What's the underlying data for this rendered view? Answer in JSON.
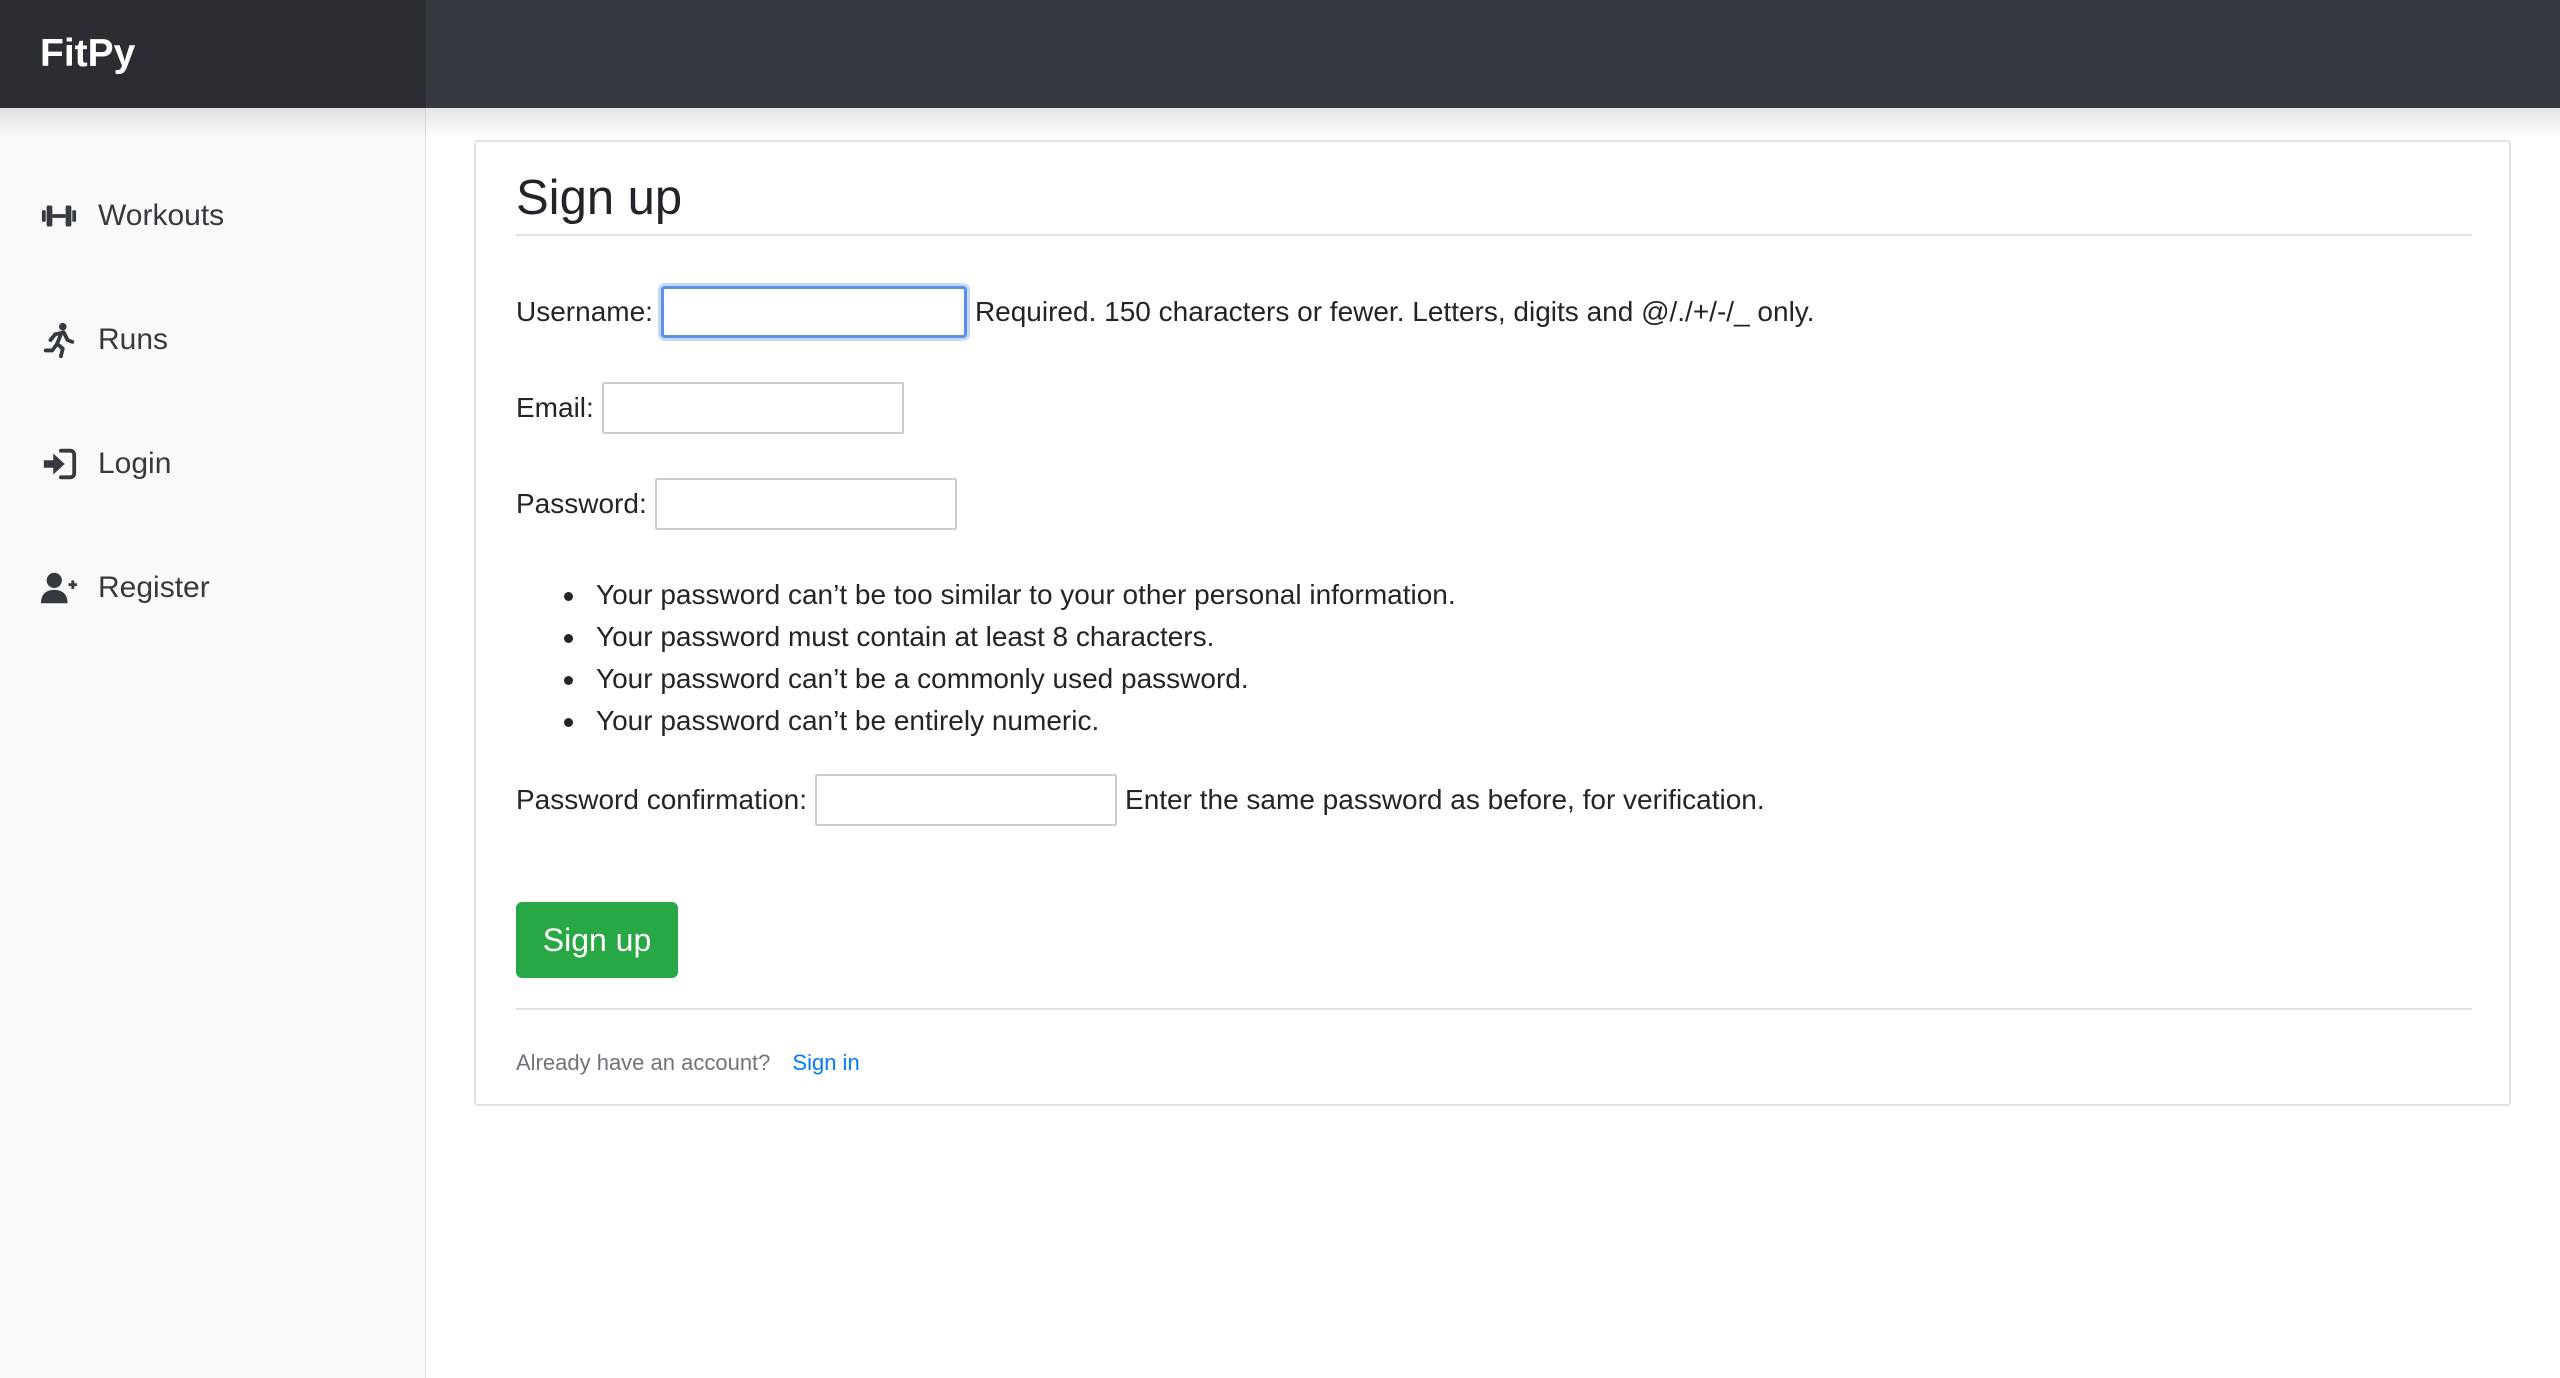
{
  "app": {
    "brand": "FitPy"
  },
  "sidebar": {
    "items": [
      {
        "label": "Workouts",
        "icon": "dumbbell-icon"
      },
      {
        "label": "Runs",
        "icon": "running-icon"
      },
      {
        "label": "Login",
        "icon": "sign-in-icon"
      },
      {
        "label": "Register",
        "icon": "user-plus-icon"
      }
    ]
  },
  "form": {
    "title": "Sign up",
    "username": {
      "label": "Username:",
      "value": "",
      "help": "Required. 150 characters or fewer. Letters, digits and @/./+/-/_ only."
    },
    "email": {
      "label": "Email:",
      "value": ""
    },
    "password": {
      "label": "Password:",
      "value": ""
    },
    "password_rules": [
      "Your password can’t be too similar to your other personal information.",
      "Your password must contain at least 8 characters.",
      "Your password can’t be a commonly used password.",
      "Your password can’t be entirely numeric."
    ],
    "password_confirmation": {
      "label": "Password confirmation:",
      "value": "",
      "help": "Enter the same password as before, for verification."
    },
    "submit_label": "Sign up"
  },
  "footer": {
    "text": "Already have an account?",
    "link_label": "Sign in"
  },
  "colors": {
    "topbar": "#343a40",
    "brand_bg": "#2a2e33",
    "sidebar_bg": "#f8f9fa",
    "submit": "#28a745",
    "link": "#007bff",
    "focus": "#5b8fe8"
  }
}
